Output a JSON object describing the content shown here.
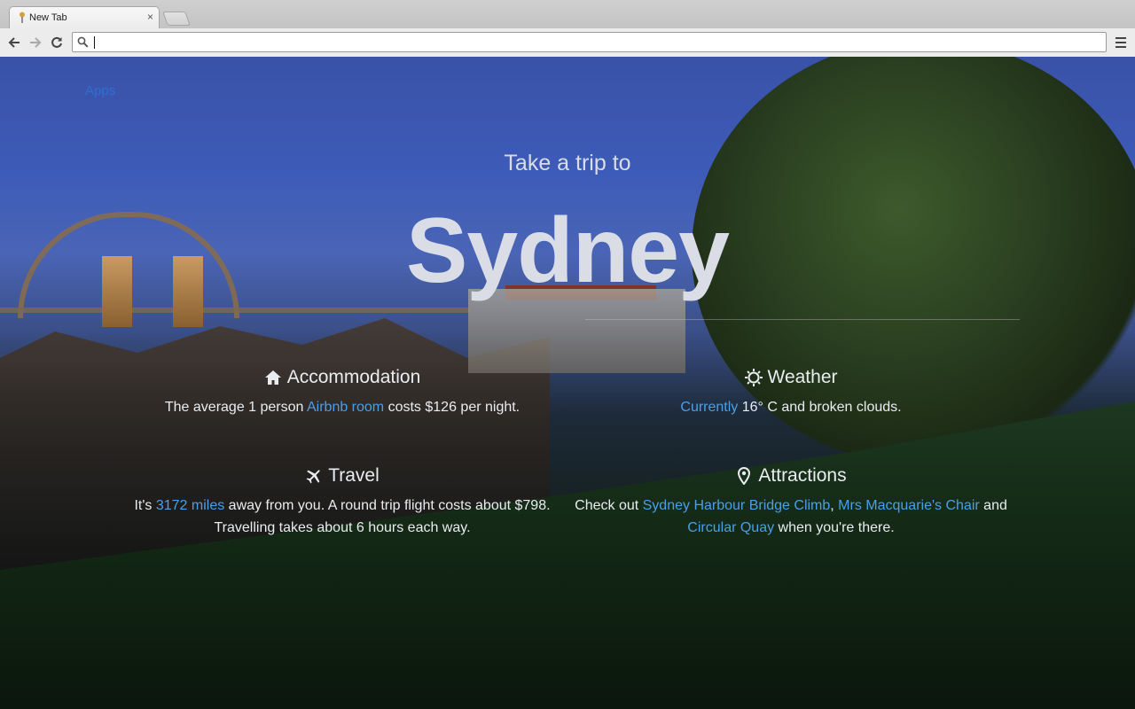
{
  "browser": {
    "tab_title": "New Tab",
    "tab_close": "×",
    "omnibox_value": "",
    "back_icon": "arrow-left-icon",
    "forward_icon": "arrow-right-icon",
    "reload_icon": "reload-icon",
    "search_icon": "magnifier-icon",
    "menu_icon": "hamburger-icon"
  },
  "page": {
    "apps_label": "Apps",
    "tagline": "Take a trip to",
    "city": "Sydney",
    "accommodation": {
      "title": "Accommodation",
      "icon": "home-icon",
      "text_before": "The average 1 person ",
      "link": "Airbnb room",
      "text_after": " costs $126 per night."
    },
    "weather": {
      "title": "Weather",
      "icon": "sun-icon",
      "link": "Currently",
      "text_after": " 16° C and broken clouds."
    },
    "travel": {
      "title": "Travel",
      "icon": "plane-icon",
      "text_before": "It's ",
      "link": "3172 miles",
      "text_after": " away from you. A round trip flight costs about $798. Travelling takes about 6 hours each way."
    },
    "attractions": {
      "title": "Attractions",
      "icon": "map-pin-icon",
      "text_before": "Check out ",
      "link1": "Sydney Harbour Bridge Climb",
      "sep1": ", ",
      "link2": "Mrs Macquarie's Chair",
      "sep2": " and ",
      "link3": "Circular Quay",
      "text_after": " when you're there."
    }
  },
  "colors": {
    "link": "#4a9fe8",
    "text": "#e9ecf0",
    "apps_link": "#2f6fd0"
  }
}
